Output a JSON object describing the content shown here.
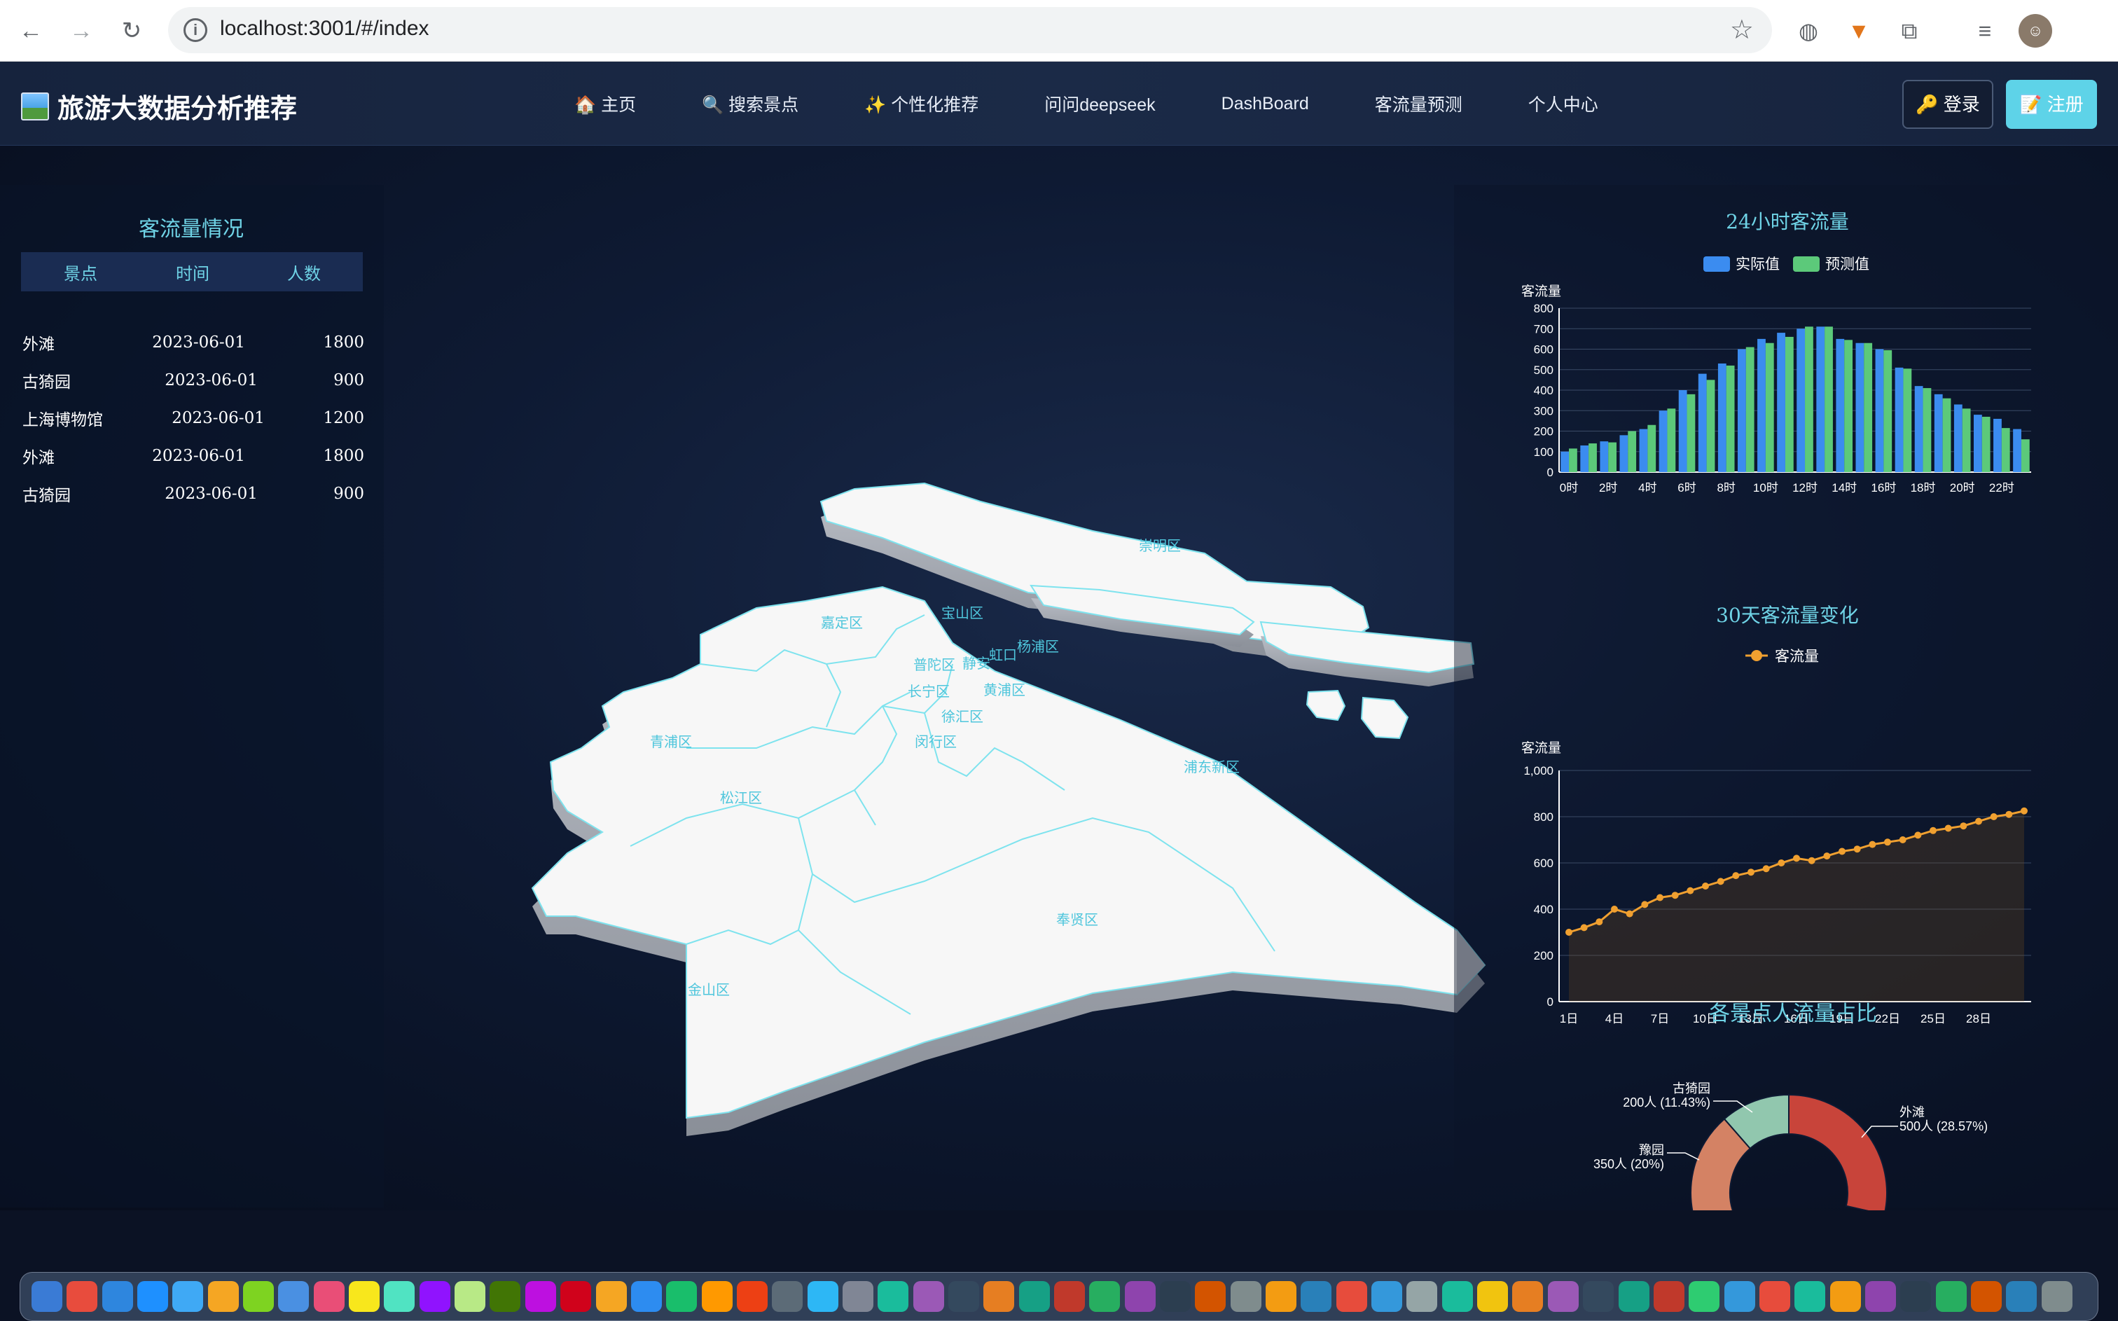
{
  "browser": {
    "url": "localhost:3001/#/index",
    "back_glyph": "←",
    "forward_glyph": "→",
    "reload_glyph": "↻",
    "star_glyph": "☆"
  },
  "header": {
    "app_title": "旅游大数据分析推荐",
    "menu": [
      {
        "label": "🏠 主页",
        "icon": "home-icon"
      },
      {
        "label": "🔍 搜索景点",
        "icon": "search-icon"
      },
      {
        "label": "✨ 个性化推荐",
        "icon": "sparkle-icon"
      },
      {
        "label": "问问deepseek",
        "icon": ""
      },
      {
        "label": "DashBoard",
        "icon": ""
      },
      {
        "label": "客流量预测",
        "icon": ""
      },
      {
        "label": "个人中心",
        "icon": ""
      }
    ],
    "login_label": "🔑 登录",
    "register_label": "📝 注册"
  },
  "left_panel": {
    "title": "客流量情况",
    "columns": [
      "景点",
      "时间",
      "人数"
    ],
    "rows": [
      {
        "spot": "外滩",
        "date": "2023-06-01",
        "count": "1800"
      },
      {
        "spot": "古猗园",
        "date": "2023-06-01",
        "count": "900"
      },
      {
        "spot": "上海博物馆",
        "date": "2023-06-01",
        "count": "1200"
      },
      {
        "spot": "外滩",
        "date": "2023-06-01",
        "count": "1800"
      },
      {
        "spot": "古猗园",
        "date": "2023-06-01",
        "count": "900"
      }
    ]
  },
  "map": {
    "districts": [
      "崇明区",
      "嘉定区",
      "宝山区",
      "杨浦区",
      "普陀区",
      "静安",
      "虹口",
      "长宁区",
      "黄浦区",
      "徐汇区",
      "闵行区",
      "青浦区",
      "松江区",
      "浦东新区",
      "奉贤区",
      "金山区"
    ]
  },
  "chart_data": [
    {
      "type": "bar",
      "title": "24小时客流量",
      "ylabel": "客流量",
      "ylim": [
        0,
        800
      ],
      "yticks": [
        0,
        100,
        200,
        300,
        400,
        500,
        600,
        700,
        800
      ],
      "categories": [
        "0时",
        "1时",
        "2时",
        "3时",
        "4时",
        "5时",
        "6时",
        "7时",
        "8时",
        "9时",
        "10时",
        "11时",
        "12时",
        "13时",
        "14时",
        "15时",
        "16时",
        "17时",
        "18时",
        "19时",
        "20时",
        "21时",
        "22时",
        "23时"
      ],
      "tick_labels": [
        "0时",
        "2时",
        "4时",
        "6时",
        "8时",
        "10时",
        "12时",
        "14时",
        "16时",
        "18时",
        "20时",
        "22时"
      ],
      "series": [
        {
          "name": "实际值",
          "color": "#3b8cf0",
          "values": [
            100,
            130,
            150,
            180,
            210,
            300,
            400,
            480,
            530,
            600,
            650,
            680,
            700,
            710,
            650,
            630,
            600,
            510,
            420,
            380,
            330,
            280,
            260,
            210
          ]
        },
        {
          "name": "预测值",
          "color": "#5cc97a",
          "values": [
            115,
            140,
            145,
            200,
            230,
            310,
            380,
            450,
            520,
            610,
            630,
            660,
            710,
            710,
            645,
            630,
            595,
            505,
            410,
            360,
            310,
            270,
            215,
            160
          ]
        }
      ]
    },
    {
      "type": "area",
      "title": "30天客流量变化",
      "ylabel": "客流量",
      "ylim": [
        0,
        1000
      ],
      "yticks": [
        0,
        200,
        400,
        600,
        800,
        1000
      ],
      "ytick_labels": [
        "0",
        "200",
        "400",
        "600",
        "800",
        "1,000"
      ],
      "x": [
        1,
        2,
        3,
        4,
        5,
        6,
        7,
        8,
        9,
        10,
        11,
        12,
        13,
        14,
        15,
        16,
        17,
        18,
        19,
        20,
        21,
        22,
        23,
        24,
        25,
        26,
        27,
        28,
        29,
        30
      ],
      "tick_labels": [
        "1日",
        "4日",
        "7日",
        "10日",
        "13日",
        "16日",
        "19日",
        "22日",
        "25日",
        "28日"
      ],
      "series": [
        {
          "name": "客流量",
          "color": "#f0a030",
          "values": [
            300,
            320,
            345,
            400,
            380,
            420,
            450,
            460,
            480,
            500,
            520,
            545,
            560,
            575,
            600,
            620,
            610,
            630,
            650,
            660,
            680,
            690,
            700,
            720,
            740,
            750,
            760,
            780,
            800,
            810,
            825
          ]
        }
      ]
    },
    {
      "type": "pie",
      "title": "各景点人流量占比",
      "slices": [
        {
          "label": "外滩",
          "value": 500,
          "pct_label": "500人 (28.57%)",
          "color": "#c8443a"
        },
        {
          "label": "豫园",
          "value": 350,
          "pct_label": "350人 (20%)",
          "color": "#d48264"
        },
        {
          "label": "古猗园",
          "value": 200,
          "pct_label": "200人 (11.43%)",
          "color": "#91c7ae"
        }
      ]
    }
  ]
}
